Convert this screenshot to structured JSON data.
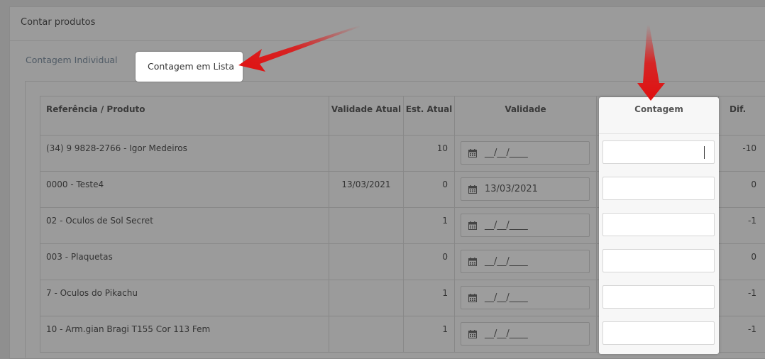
{
  "panel": {
    "title": "Contar produtos"
  },
  "tabs": {
    "individual": "Contagem Individual",
    "lista": "Contagem em Lista"
  },
  "table": {
    "headers": {
      "produto": "Referência / Produto",
      "validade_atual": "Validade Atual",
      "est_atual": "Est. Atual",
      "validade": "Validade",
      "contagem": "Contagem",
      "dif": "Dif."
    },
    "rows": [
      {
        "produto": "(34) 9 9828-2766 - Igor Medeiros",
        "validade_atual": "",
        "est_atual": "10",
        "validade": "__/__/____",
        "contagem": "",
        "dif": "-10"
      },
      {
        "produto": "0000 - Teste4",
        "validade_atual": "13/03/2021",
        "est_atual": "0",
        "validade": "13/03/2021",
        "contagem": "",
        "dif": "0"
      },
      {
        "produto": "02 - Oculos de Sol Secret",
        "validade_atual": "",
        "est_atual": "1",
        "validade": "__/__/____",
        "contagem": "",
        "dif": "-1"
      },
      {
        "produto": "003 - Plaquetas",
        "validade_atual": "",
        "est_atual": "0",
        "validade": "__/__/____",
        "contagem": "",
        "dif": "0"
      },
      {
        "produto": "7 - Oculos do Pikachu",
        "validade_atual": "",
        "est_atual": "1",
        "validade": "__/__/____",
        "contagem": "",
        "dif": "-1"
      },
      {
        "produto": "10 - Arm.gian Bragi T155 Cor 113 Fem",
        "validade_atual": "",
        "est_atual": "1",
        "validade": "__/__/____",
        "contagem": "",
        "dif": "-1"
      }
    ]
  },
  "colors": {
    "overlay": "#8f8f8f",
    "highlight": "#ffffff",
    "arrow": "#e01010"
  }
}
